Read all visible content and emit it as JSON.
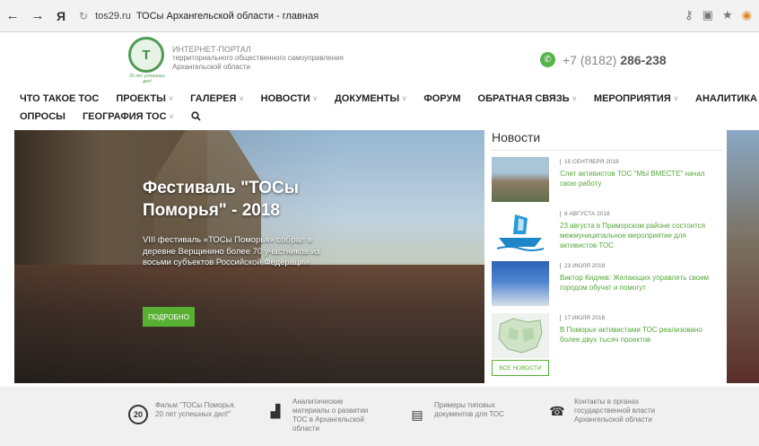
{
  "browser": {
    "back_icon": "arrow-left-icon",
    "forward_icon": "arrow-right-icon",
    "yandex_label": "Я",
    "host": "tos29.ru",
    "page_title": "ТОСы Архангельской области - главная"
  },
  "header": {
    "portal_line1": "ИНТЕРНЕТ-ПОРТАЛ",
    "portal_line2": "территориального общественного самоуправления",
    "portal_line3": "Архангельской области",
    "logo_caption": "20 лет успешных дел!",
    "phone_code": "+7 (8182)",
    "phone_number": "286-238",
    "accent_color": "#58b032"
  },
  "menu": {
    "row1": [
      {
        "label": "ЧТО ТАКОЕ ТОС",
        "has_dropdown": false
      },
      {
        "label": "ПРОЕКТЫ",
        "has_dropdown": true
      },
      {
        "label": "ГАЛЕРЕЯ",
        "has_dropdown": true
      },
      {
        "label": "НОВОСТИ",
        "has_dropdown": true
      },
      {
        "label": "ДОКУМЕНТЫ",
        "has_dropdown": true
      },
      {
        "label": "ФОРУМ",
        "has_dropdown": false
      },
      {
        "label": "ОБРАТНАЯ СВЯЗЬ",
        "has_dropdown": true
      },
      {
        "label": "МЕРОПРИЯТИЯ",
        "has_dropdown": true
      },
      {
        "label": "АНАЛИТИКА",
        "has_dropdown": false
      }
    ],
    "row2": [
      {
        "label": "ОПРОСЫ",
        "has_dropdown": false
      },
      {
        "label": "ГЕОГРАФИЯ ТОС",
        "has_dropdown": true
      }
    ],
    "chevron": "˅",
    "search_icon": "search-icon"
  },
  "hero": {
    "title": "Фестиваль \"ТОСы Поморья\" - 2018",
    "text": "VIII фестиваль «ТОСы Поморья» собрал в деревне Верщинино более 70 участников из восьми субъектов Российской Федерации",
    "button_label": "ПОДРОБНО"
  },
  "news": {
    "title": "Новости",
    "items": [
      {
        "date": "15 СЕНТЯБРЯ 2018",
        "headline": "Слет активистов ТОС \"МЫ ВМЕСТЕ\" начал свою работу"
      },
      {
        "date": "8 АВГУСТА 2018",
        "headline": "23 августа в Приморском районе состоится межмуниципальное мероприятие для активистов ТОС"
      },
      {
        "date": "23 ИЮЛЯ 2018",
        "headline": "Виктор Кидяев: Желающих управлять своим городом обучат и помогут"
      },
      {
        "date": "17 ИЮЛЯ 2018",
        "headline": "В Поморье активистами ТОС реализовано более двух тысяч проектов"
      }
    ],
    "all_label": "ВСЕ НОВОСТИ"
  },
  "features": [
    {
      "icon": "badge-20-icon",
      "glyph": "20",
      "label": "Фильм \"ТОСы Поморья. 20 лет успешных дел!\""
    },
    {
      "icon": "bar-chart-icon",
      "glyph": "▟",
      "label": "Аналитические материалы о развитии ТОС в Архангельской области"
    },
    {
      "icon": "document-icon",
      "glyph": "▤",
      "label": "Примеры типовых документов для ТОС"
    },
    {
      "icon": "telephone-icon",
      "glyph": "☎",
      "label": "Контакты в органах государственной власти Архангельской области"
    }
  ]
}
